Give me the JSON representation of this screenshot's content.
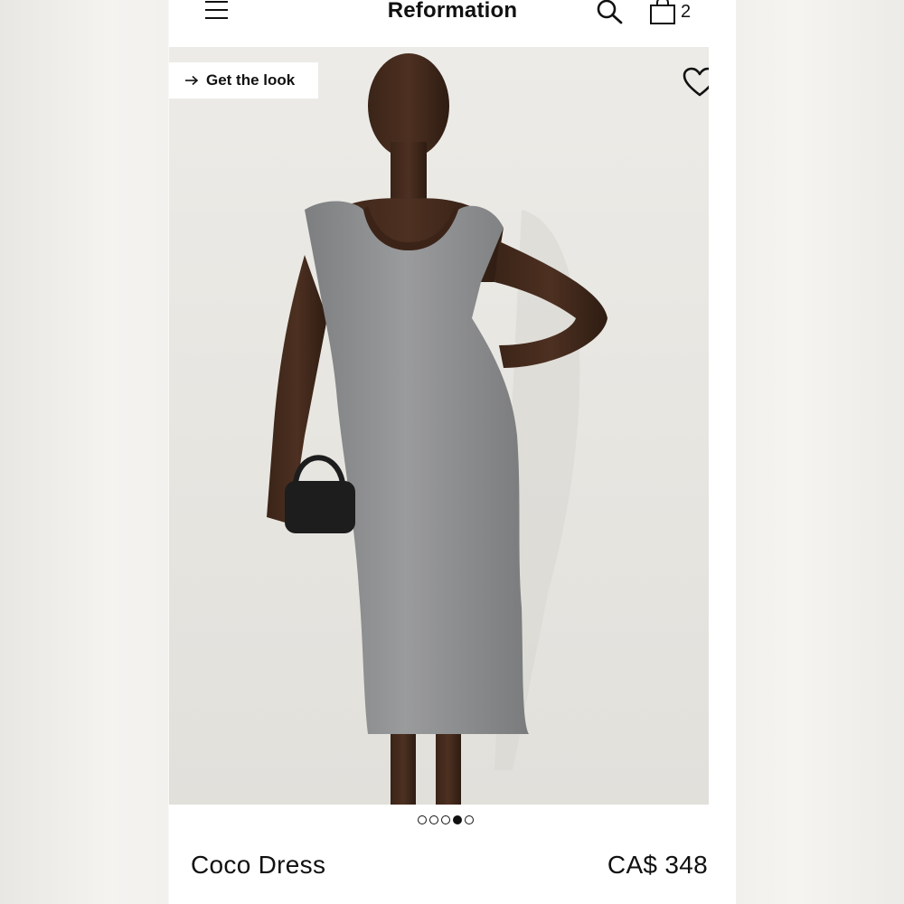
{
  "header": {
    "brand": "Reformation",
    "menu_icon": "hamburger-menu-icon",
    "search_icon": "search-icon",
    "bag_icon": "shopping-bag-icon",
    "bag_count": "2"
  },
  "hero": {
    "get_look_label": "Get the look",
    "arrow_icon": "arrow-right-icon",
    "favorite_icon": "heart-outline-icon"
  },
  "gallery": {
    "image_count": 5,
    "active_index": 3
  },
  "product": {
    "name": "Coco Dress",
    "price": "CA$ 348"
  },
  "colors": {
    "background": "#ffffff",
    "text": "#111111",
    "photo_backdrop": "#e8e6e1",
    "dress_gray": "#8f9092"
  }
}
